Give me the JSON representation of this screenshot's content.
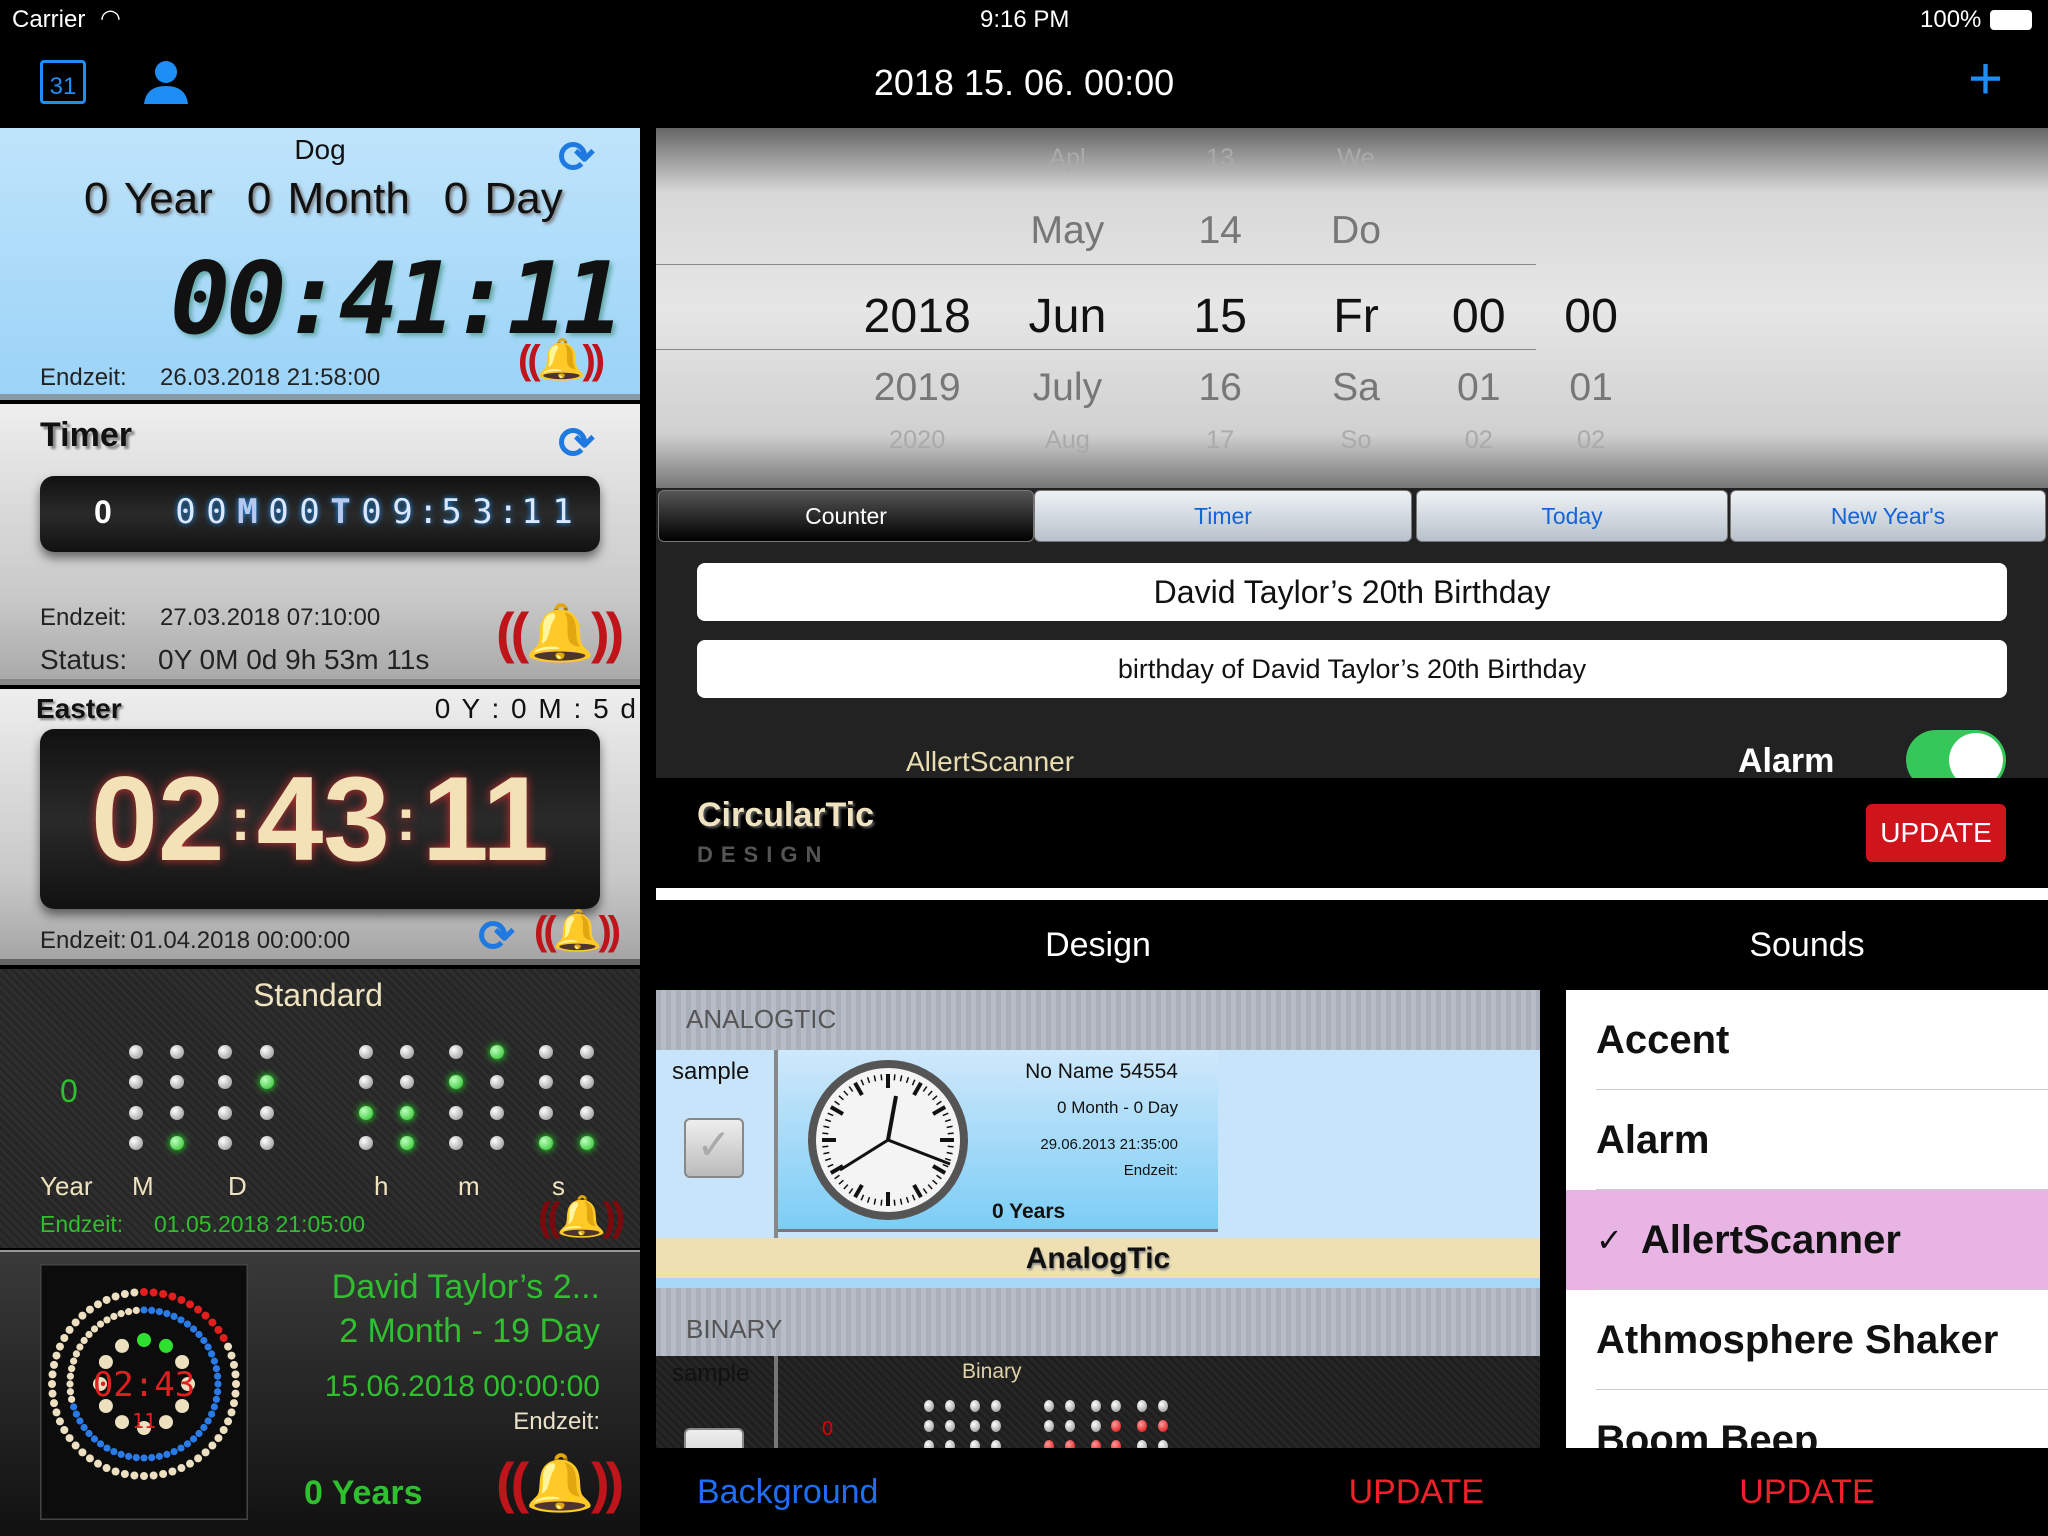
{
  "status_bar": {
    "carrier": "Carrier",
    "time": "9:16 PM",
    "battery": "100%"
  },
  "nav": {
    "title": "2018  15. 06.  00:00",
    "calendar_day": "31",
    "add": "+"
  },
  "dog": {
    "title": "Dog",
    "years": "0 Year",
    "months": "0 Month",
    "days": "0 Day",
    "clock": "00:41:11",
    "endzeit_label": "Endzeit:",
    "endzeit": "26.03.2018 21:58:00"
  },
  "timer": {
    "title": "Timer",
    "year_digit": "0",
    "digits": [
      "0",
      "0",
      "M",
      "0",
      "0",
      "T",
      "0",
      "9",
      ":",
      "5",
      "3",
      ":",
      "1",
      "1"
    ],
    "endzeit_label": "Endzeit:",
    "endzeit": "27.03.2018 07:10:00",
    "status_label": "Status:",
    "status": "0Y 0M 0d 9h 53m 11s"
  },
  "easter": {
    "title": "Easter",
    "summary": "0 Y : 0 M : 5 d",
    "hours": "02",
    "minutes": "43",
    "seconds": "11",
    "endzeit_label": "Endzeit:",
    "endzeit": "01.04.2018 00:00:00"
  },
  "standard": {
    "title": "Standard",
    "year_value": "0",
    "labels": [
      "Year",
      "M",
      "D",
      "h",
      "m",
      "s"
    ],
    "endzeit_label": "Endzeit:",
    "endzeit": "01.05.2018 21:05:00",
    "led_left": [
      [
        0,
        0,
        0,
        0
      ],
      [
        0,
        0,
        0,
        1
      ],
      [
        0,
        0,
        0,
        0
      ],
      [
        0,
        1,
        0,
        0
      ]
    ],
    "led_right": [
      [
        0,
        0,
        0,
        1,
        0,
        0
      ],
      [
        0,
        0,
        1,
        0,
        0,
        0
      ],
      [
        1,
        1,
        0,
        0,
        0,
        0
      ],
      [
        0,
        1,
        0,
        0,
        1,
        1
      ]
    ]
  },
  "david_card": {
    "title": "David Taylor’s 2...",
    "months_days": "2 Month - 19 Day",
    "date": "15.06.2018 00:00:00",
    "endzeit_label": "Endzeit:",
    "years": "0 Years",
    "clock_time": "02:43",
    "clock_seconds": "11"
  },
  "picker": {
    "rows": [
      [
        "",
        "Apl",
        "13",
        "We",
        "",
        ""
      ],
      [
        "",
        "May",
        "14",
        "Do",
        "",
        ""
      ],
      [
        "2018",
        "Jun",
        "15",
        "Fr",
        "00",
        "00"
      ],
      [
        "2019",
        "July",
        "16",
        "Sa",
        "01",
        "01"
      ],
      [
        "2020",
        "Aug",
        "17",
        "So",
        "02",
        "02"
      ]
    ]
  },
  "segments": [
    {
      "label": "Counter",
      "active": true
    },
    {
      "label": "Timer"
    },
    {
      "label": "Today"
    },
    {
      "label": "New Year's"
    }
  ],
  "form": {
    "title_value": "David Taylor’s 20th Birthday",
    "subtitle_value": "birthday of David Taylor’s 20th Birthday",
    "sound_name": "AllertScanner",
    "alarm_label": "Alarm",
    "alarm_on": true
  },
  "design_header": {
    "name": "CircularTic",
    "sub": "DESIGN",
    "update": "UPDATE"
  },
  "design": {
    "title": "Design",
    "sections": [
      {
        "header": "ANALOGTIC",
        "sample": "sample",
        "name": "No Name 54554",
        "months_days": "0 Month - 0 Day",
        "date": "29.06.2013 21:35:00",
        "endzeit_label": "Endzeit:",
        "years": "0 Years",
        "caption": "AnalogTic"
      },
      {
        "header": "BINARY",
        "sample": "sample",
        "preview_title": "Binary",
        "year_value": "0"
      }
    ],
    "background": "Background",
    "update": "UPDATE"
  },
  "sounds": {
    "title": "Sounds",
    "items": [
      "Accent",
      "Alarm",
      "AllertScanner",
      "Athmosphere Shaker",
      "Boom Beep"
    ],
    "selected": "AllertScanner",
    "check": "✓",
    "update": "UPDATE"
  },
  "colors": {
    "accent": "#1e8ef5",
    "alarm_red": "#c0141b",
    "green": "#2fbf2f",
    "selected_sound": "#e8b4e4"
  }
}
